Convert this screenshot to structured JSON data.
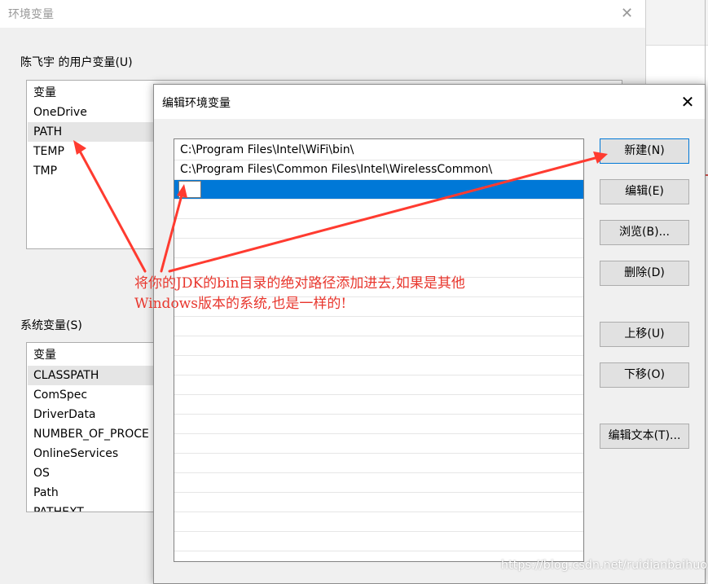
{
  "background_dialog": {
    "title": "环境变量",
    "user_vars_label": "陈飞宇 的用户变量(U)",
    "user_vars_header": "变量",
    "user_vars": [
      "OneDrive",
      "PATH",
      "TEMP",
      "TMP"
    ],
    "selected_user_var": "PATH",
    "system_vars_label": "系统变量(S)",
    "system_vars_header": "变量",
    "system_vars": [
      "CLASSPATH",
      "ComSpec",
      "DriverData",
      "NUMBER_OF_PROCE",
      "OnlineServices",
      "OS",
      "Path",
      "PATHEXT"
    ],
    "selected_system_var": "CLASSPATH"
  },
  "edit_dialog": {
    "title": "编辑环境变量",
    "close_glyph": "✕",
    "entries": [
      "C:\\Program Files\\Intel\\WiFi\\bin\\",
      "C:\\Program Files\\Common Files\\Intel\\WirelessCommon\\"
    ],
    "editing_value": "",
    "buttons": {
      "new": "新建(N)",
      "edit": "编辑(E)",
      "browse": "浏览(B)...",
      "delete": "删除(D)",
      "move_up": "上移(U)",
      "move_down": "下移(O)",
      "edit_text": "编辑文本(T)..."
    }
  },
  "annotation": {
    "line1": "将你的JDK的bin目录的绝对路径添加进去,如果是其他",
    "line2": "Windows版本的系统,也是一样的!",
    "color": "#e8362d"
  },
  "watermark": "https://blog.csdn.net/ruidianbaihuo",
  "colors": {
    "selection": "#0078d7",
    "button_bg": "#e1e1e1"
  }
}
